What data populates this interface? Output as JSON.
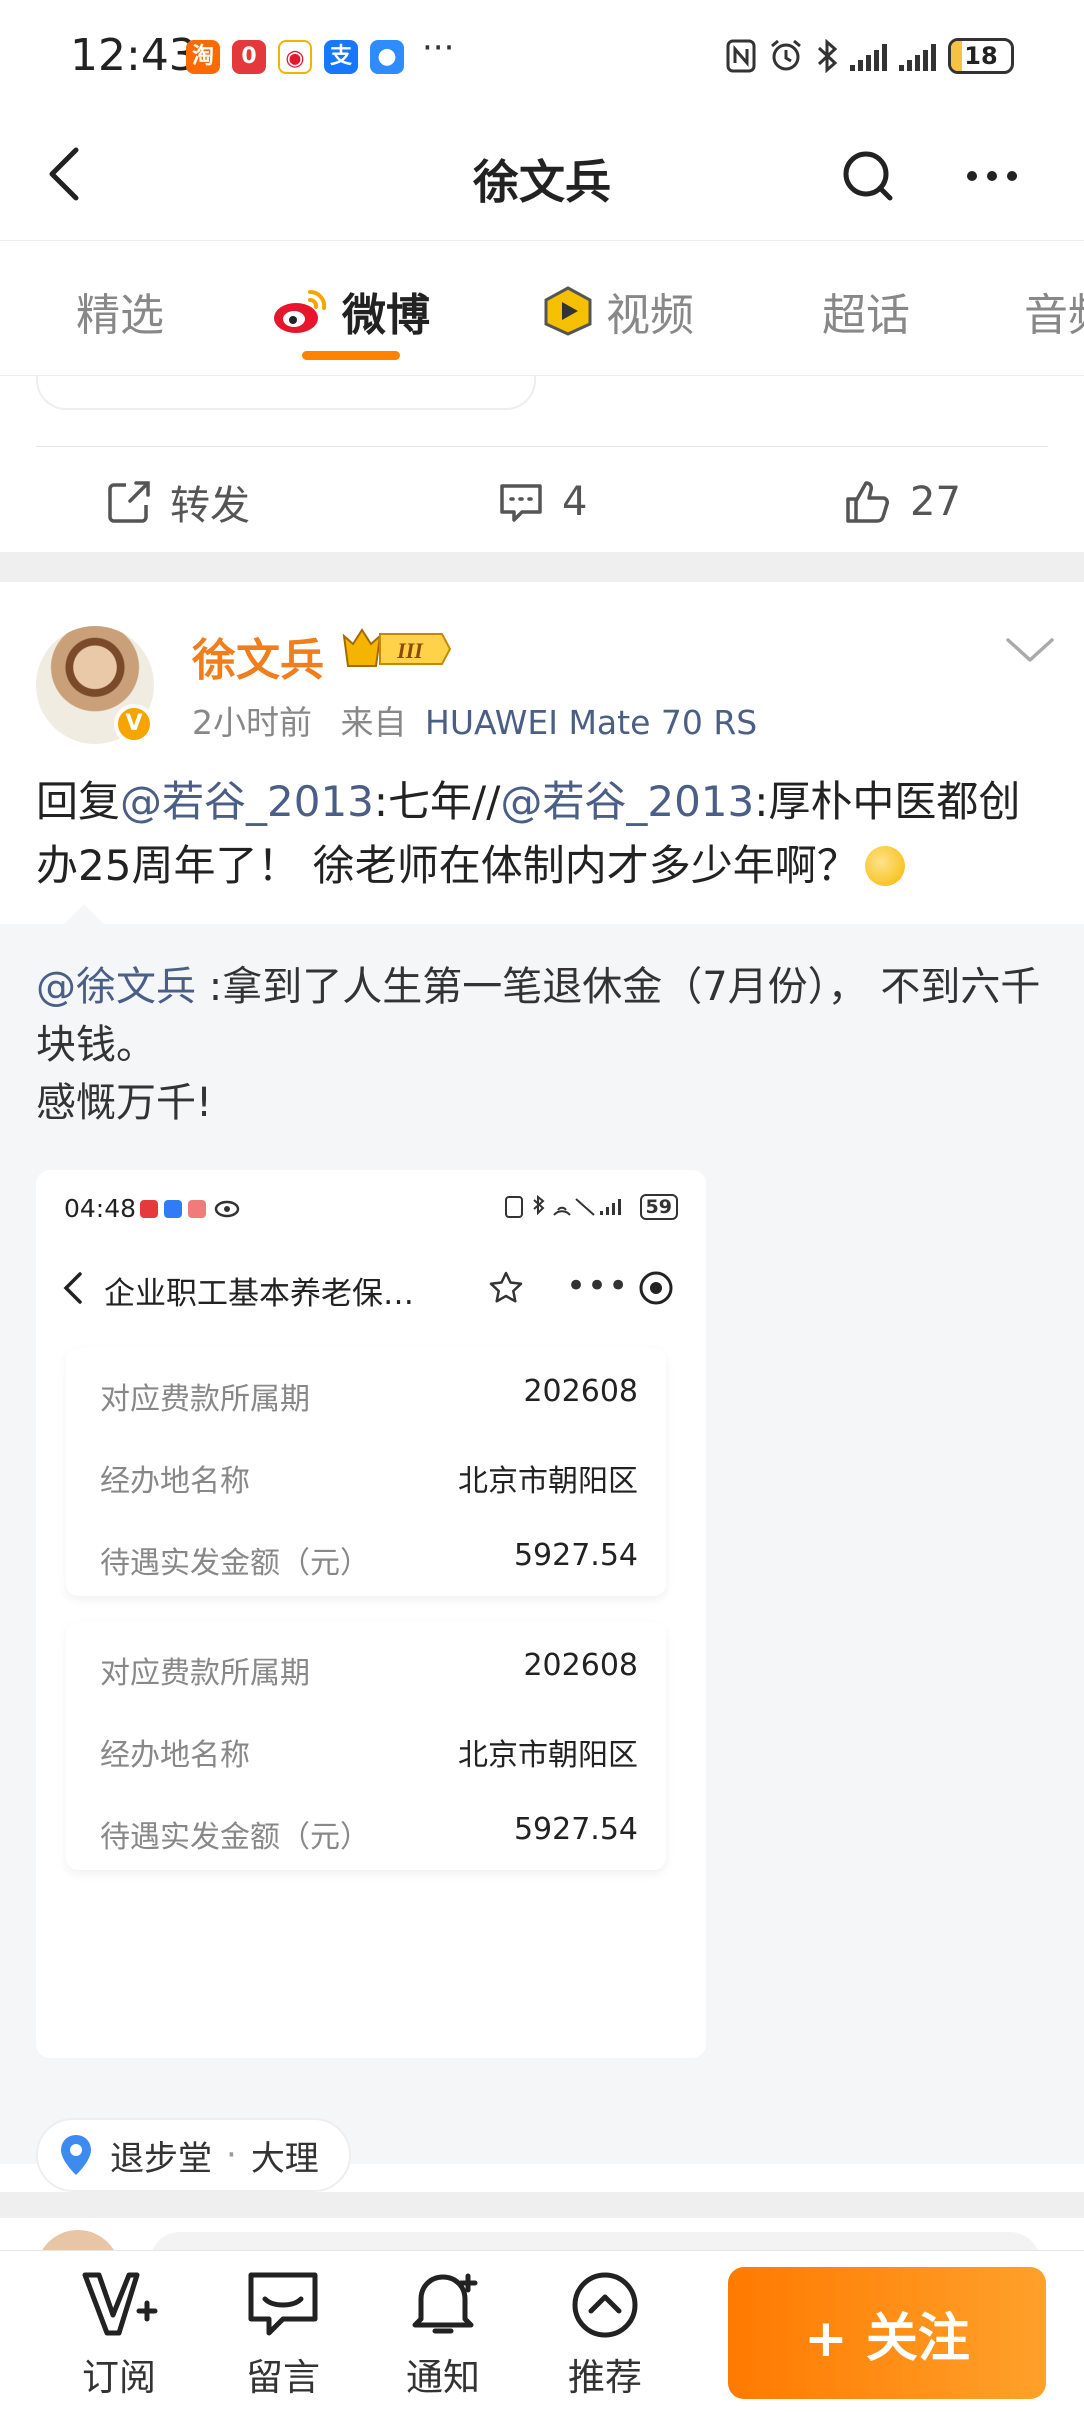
{
  "status_bar": {
    "time": "12:43",
    "more": "···",
    "battery": "18",
    "apps": [
      {
        "name": "taobao-icon",
        "glyph": "淘",
        "color": "#ff6a00"
      },
      {
        "name": "jd-icon",
        "glyph": "0",
        "color": "#e4393c"
      },
      {
        "name": "weibo-app-icon",
        "glyph": "◉",
        "color": "#e6162d"
      },
      {
        "name": "alipay-icon",
        "glyph": "支",
        "color": "#1677ff"
      },
      {
        "name": "message-app-icon",
        "glyph": "●",
        "color": "#2f8cff"
      }
    ]
  },
  "header": {
    "title": "徐文兵"
  },
  "tabs": [
    {
      "label": "精选",
      "active": false
    },
    {
      "label": "微博",
      "active": true
    },
    {
      "label": "视频",
      "active": false
    },
    {
      "label": "超话",
      "active": false
    },
    {
      "label": "音频",
      "active": false
    }
  ],
  "prev_post": {
    "repost_label": "转发",
    "comment_count": "4",
    "like_count": "27"
  },
  "post": {
    "author": "徐文兵",
    "vip_level": "III",
    "time": "2小时前",
    "source_prefix": "来自",
    "source": "HUAWEI Mate 70 RS",
    "text": {
      "reply_prefix": "回复",
      "mention1": "@若谷_2013",
      "part1": ":七年//",
      "mention2": "@若谷_2013",
      "part2": ":厚朴中医都创办25周年了！ 徐老师在体制内才多少年啊？"
    },
    "quote": {
      "mention": "@徐文兵",
      "line1": " :拿到了人生第一笔退休金（7月份）， 不到六千块钱。",
      "line2": "感慨万千!"
    },
    "embedded_screenshot": {
      "time": "04:48",
      "battery": "59",
      "title": "企业职工基本养老保…",
      "cards": [
        {
          "rows": [
            {
              "label": "对应费款所属期",
              "value": "202608"
            },
            {
              "label": "经办地名称",
              "value": "北京市朝阳区"
            },
            {
              "label": "待遇实发金额（元）",
              "value": "5927.54"
            }
          ]
        },
        {
          "rows": [
            {
              "label": "对应费款所属期",
              "value": "202608"
            },
            {
              "label": "经办地名称",
              "value": "北京市朝阳区"
            },
            {
              "label": "待遇实发金额（元）",
              "value": "5927.54"
            }
          ]
        }
      ]
    },
    "location": {
      "name": "退步堂",
      "separator": "·",
      "city": "大理"
    }
  },
  "bottom_bar": {
    "items": [
      {
        "label": "订阅",
        "icon": "subscribe-icon"
      },
      {
        "label": "留言",
        "icon": "message-icon"
      },
      {
        "label": "通知",
        "icon": "bell-icon"
      },
      {
        "label": "推荐",
        "icon": "recommend-icon"
      }
    ],
    "follow_label": "+ 关注"
  },
  "colors": {
    "accent": "#ff8200",
    "author": "#f07f1b",
    "mention": "#4a5e86"
  }
}
